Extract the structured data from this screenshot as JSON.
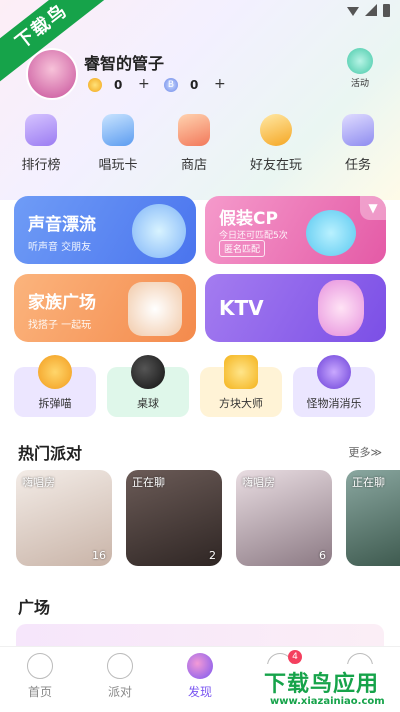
{
  "watermark_corner": "下载鸟",
  "user": {
    "name": "睿智的管子",
    "gold_value": "0",
    "gold_plus": "+",
    "diamond_value": "0",
    "diamond_plus": "+",
    "diamond_symbol": "B"
  },
  "activity_label": "活动",
  "entries": [
    {
      "label": "排行榜",
      "icon": "trophy-icon"
    },
    {
      "label": "唱玩卡",
      "icon": "card-icon"
    },
    {
      "label": "商店",
      "icon": "shop-icon"
    },
    {
      "label": "好友在玩",
      "icon": "friends-icon"
    },
    {
      "label": "任务",
      "icon": "task-icon"
    }
  ],
  "cards": {
    "voice": {
      "title": "声音漂流",
      "subtitle": "听声音 交朋友"
    },
    "cp": {
      "title": "假装CP",
      "subtitle": "今日还可匹配5次",
      "tag": "匿名匹配"
    },
    "family": {
      "title": "家族广场",
      "subtitle": "找搭子 一起玩"
    },
    "ktv": {
      "title": "KTV"
    }
  },
  "games": [
    {
      "label": "拆弹喵"
    },
    {
      "label": "桌球"
    },
    {
      "label": "方块大师"
    },
    {
      "label": "怪物消消乐"
    }
  ],
  "hot_party": {
    "title": "热门派对",
    "more": "更多≫",
    "rooms": [
      {
        "tag": "嗨唱房",
        "count": "16"
      },
      {
        "tag": "正在聊",
        "count": "2"
      },
      {
        "tag": "嗨唱房",
        "count": "6"
      },
      {
        "tag": "正在聊",
        "count": ""
      }
    ]
  },
  "square_title": "广场",
  "nav": {
    "home": "首页",
    "party": "派对",
    "discover": "发现",
    "badge": "4"
  },
  "watermark": {
    "brand": "下载鸟应用",
    "url": "www.xiazainiao.com"
  },
  "colors": {
    "accent": "#7a56f1",
    "watermark_green": "#16a34a"
  }
}
